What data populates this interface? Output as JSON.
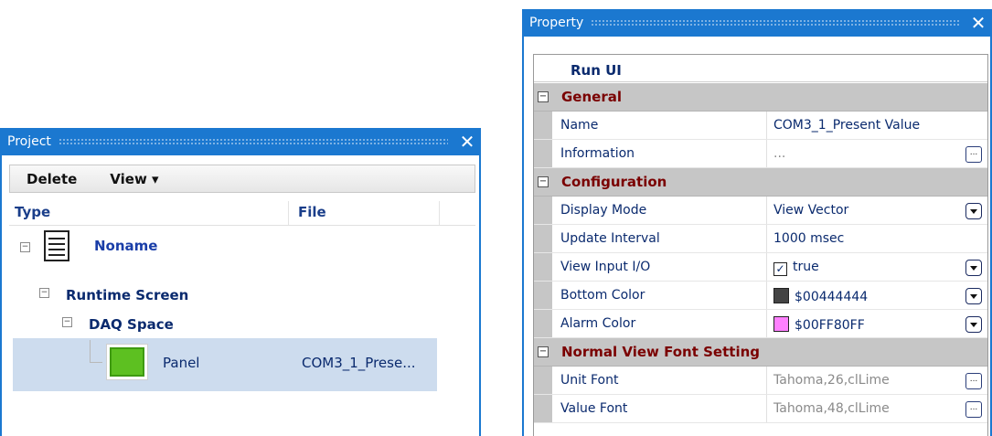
{
  "project": {
    "title": "Project",
    "close": "✕",
    "toolbar": {
      "delete": "Delete",
      "view": "View ▾"
    },
    "columns": {
      "type": "Type",
      "file": "File"
    },
    "tree": {
      "root": "Noname",
      "runtime_screen": "Runtime Screen",
      "daq_space": "DAQ Space",
      "panel": "Panel",
      "panel_file": "COM3_1_Prese..."
    }
  },
  "property": {
    "title": "Property",
    "close": "✕",
    "header": "Run UI",
    "categories": {
      "general": "General",
      "configuration": "Configuration",
      "font": "Normal View Font Setting"
    },
    "rows": {
      "name": {
        "label": "Name",
        "value": "COM3_1_Present Value"
      },
      "information": {
        "label": "Information",
        "value": "..."
      },
      "display_mode": {
        "label": "Display Mode",
        "value": "View Vector"
      },
      "update_interval": {
        "label": "Update Interval",
        "value": "1000 msec"
      },
      "view_input": {
        "label": "View Input I/O",
        "value": "true",
        "checked": "☑"
      },
      "bottom_color": {
        "label": "Bottom Color",
        "value": "$00444444",
        "color": "#444444"
      },
      "alarm_color": {
        "label": "Alarm Color",
        "value": "$00FF80FF",
        "color": "#FF80FF"
      },
      "unit_font": {
        "label": "Unit Font",
        "value": "Tahoma,26,clLime"
      },
      "value_font": {
        "label": "Value Font",
        "value": "Tahoma,48,clLime"
      }
    },
    "ellipsis": "...",
    "collapse": "−"
  },
  "colors": {
    "accent": "#1B78D0",
    "panel_icon": "#5DC021",
    "category_text": "#7A0000",
    "selection": "#CDDCEE"
  }
}
